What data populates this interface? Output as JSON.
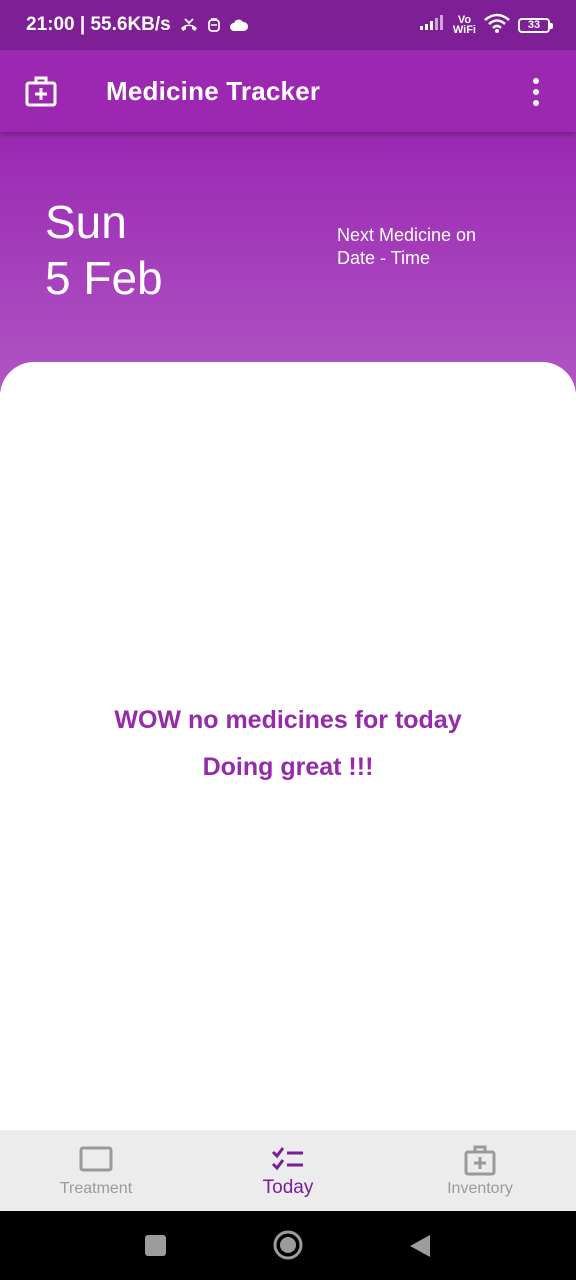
{
  "status_bar": {
    "time_speed": "21:00 | 55.6KB/s",
    "vowifi_top": "Vo",
    "vowifi_bottom": "WiFi",
    "battery": "33"
  },
  "app_bar": {
    "title": "Medicine Tracker",
    "icon": "medical-bag-icon",
    "menu_icon": "more-vertical-icon"
  },
  "header": {
    "day": "Sun",
    "date": "5 Feb",
    "next_medicine_title": "Next Medicine on",
    "next_medicine_time": "Date - Time"
  },
  "content": {
    "empty_line1": "WOW no medicines for today",
    "empty_line2": "Doing great !!!"
  },
  "bottom_nav": {
    "items": [
      {
        "label": "Treatment",
        "icon": "rectangle-icon",
        "active": false
      },
      {
        "label": "Today",
        "icon": "checklist-icon",
        "active": true
      },
      {
        "label": "Inventory",
        "icon": "medical-bag-icon",
        "active": false
      }
    ]
  },
  "colors": {
    "primary": "#9c27b0",
    "status_bar": "#7e1f95",
    "accent_text": "#962aab",
    "nav_active": "#7b1d99",
    "nav_inactive": "#9a9a9a"
  }
}
